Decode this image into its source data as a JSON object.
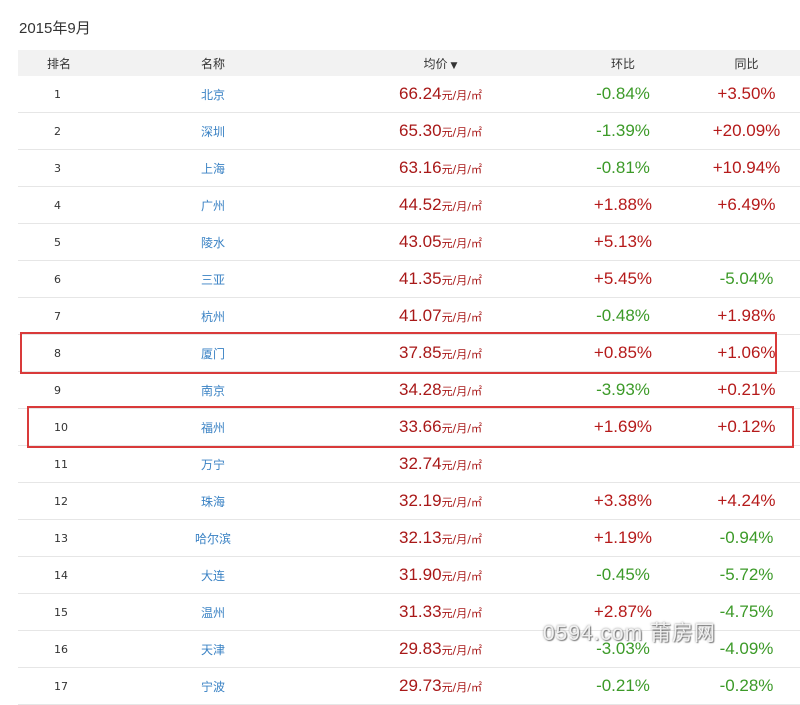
{
  "heading": "2015年9月",
  "columns": {
    "rank": "排名",
    "name": "名称",
    "price": "均价",
    "mom": "环比",
    "yoy": "同比",
    "sort_icon": "sort-down-icon"
  },
  "price_unit": "元/月/㎡",
  "rows": [
    {
      "rank": "1",
      "name": "北京",
      "price": "66.24",
      "mom": "-0.84%",
      "yoy": "+3.50%"
    },
    {
      "rank": "2",
      "name": "深圳",
      "price": "65.30",
      "mom": "-1.39%",
      "yoy": "+20.09%"
    },
    {
      "rank": "3",
      "name": "上海",
      "price": "63.16",
      "mom": "-0.81%",
      "yoy": "+10.94%"
    },
    {
      "rank": "4",
      "name": "广州",
      "price": "44.52",
      "mom": "+1.88%",
      "yoy": "+6.49%"
    },
    {
      "rank": "5",
      "name": "陵水",
      "price": "43.05",
      "mom": "+5.13%",
      "yoy": ""
    },
    {
      "rank": "6",
      "name": "三亚",
      "price": "41.35",
      "mom": "+5.45%",
      "yoy": "-5.04%"
    },
    {
      "rank": "7",
      "name": "杭州",
      "price": "41.07",
      "mom": "-0.48%",
      "yoy": "+1.98%"
    },
    {
      "rank": "8",
      "name": "厦门",
      "price": "37.85",
      "mom": "+0.85%",
      "yoy": "+1.06%"
    },
    {
      "rank": "9",
      "name": "南京",
      "price": "34.28",
      "mom": "-3.93%",
      "yoy": "+0.21%"
    },
    {
      "rank": "10",
      "name": "福州",
      "price": "33.66",
      "mom": "+1.69%",
      "yoy": "+0.12%"
    },
    {
      "rank": "11",
      "name": "万宁",
      "price": "32.74",
      "mom": "",
      "yoy": ""
    },
    {
      "rank": "12",
      "name": "珠海",
      "price": "32.19",
      "mom": "+3.38%",
      "yoy": "+4.24%"
    },
    {
      "rank": "13",
      "name": "哈尔滨",
      "price": "32.13",
      "mom": "+1.19%",
      "yoy": "-0.94%"
    },
    {
      "rank": "14",
      "name": "大连",
      "price": "31.90",
      "mom": "-0.45%",
      "yoy": "-5.72%"
    },
    {
      "rank": "15",
      "name": "温州",
      "price": "31.33",
      "mom": "+2.87%",
      "yoy": "-4.75%"
    },
    {
      "rank": "16",
      "name": "天津",
      "price": "29.83",
      "mom": "-3.03%",
      "yoy": "-4.09%"
    },
    {
      "rank": "17",
      "name": "宁波",
      "price": "29.73",
      "mom": "-0.21%",
      "yoy": "-0.28%"
    }
  ],
  "highlighted_ranks": [
    "8",
    "10"
  ],
  "colors": {
    "positive": "#b51a1a",
    "negative": "#3c9a28",
    "link": "#3a82c4",
    "highlight": "#d93a3a"
  },
  "watermark": "0594.com 莆房网"
}
